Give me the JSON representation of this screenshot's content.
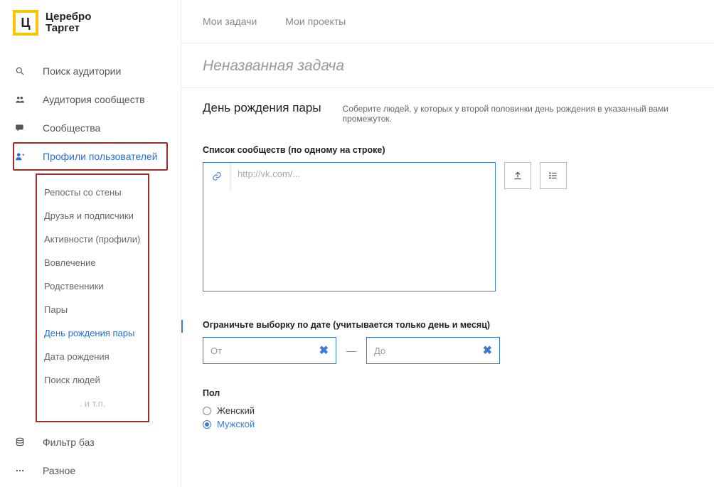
{
  "brand": {
    "line1": "Церебро",
    "line2": "Таргет",
    "logo_letter": "Ц"
  },
  "tabs": {
    "tasks": "Мои задачи",
    "projects": "Мои проекты"
  },
  "page_title": "Неназванная задача",
  "sidebar": {
    "items": [
      {
        "label": "Поиск аудитории"
      },
      {
        "label": "Аудитория сообществ"
      },
      {
        "label": "Сообщества"
      },
      {
        "label": "Профили пользователей"
      },
      {
        "label": "Фильтр баз"
      },
      {
        "label": "Разное"
      }
    ],
    "sub": [
      {
        "label": "Репосты со стены"
      },
      {
        "label": "Друзья и подписчики"
      },
      {
        "label": "Активности (профили)"
      },
      {
        "label": "Вовлечение"
      },
      {
        "label": "Родственники"
      },
      {
        "label": "Пары"
      },
      {
        "label": "День рождения пары"
      },
      {
        "label": "Дата рождения"
      },
      {
        "label": "Поиск людей"
      },
      {
        "label": ". и т.п."
      }
    ]
  },
  "section": {
    "title": "День рождения пары",
    "desc": "Соберите людей, у которых у второй половинки день рождения в указанный вами промежуток."
  },
  "list": {
    "label": "Список сообществ (по одному на строке)",
    "placeholder": "http://vk.com/..."
  },
  "date": {
    "label": "Ограничьте выборку по дате (учитывается только день и месяц)",
    "from_ph": "От",
    "to_ph": "До",
    "dash": "—"
  },
  "gender": {
    "label": "Пол",
    "female": "Женский",
    "male": "Мужской"
  }
}
